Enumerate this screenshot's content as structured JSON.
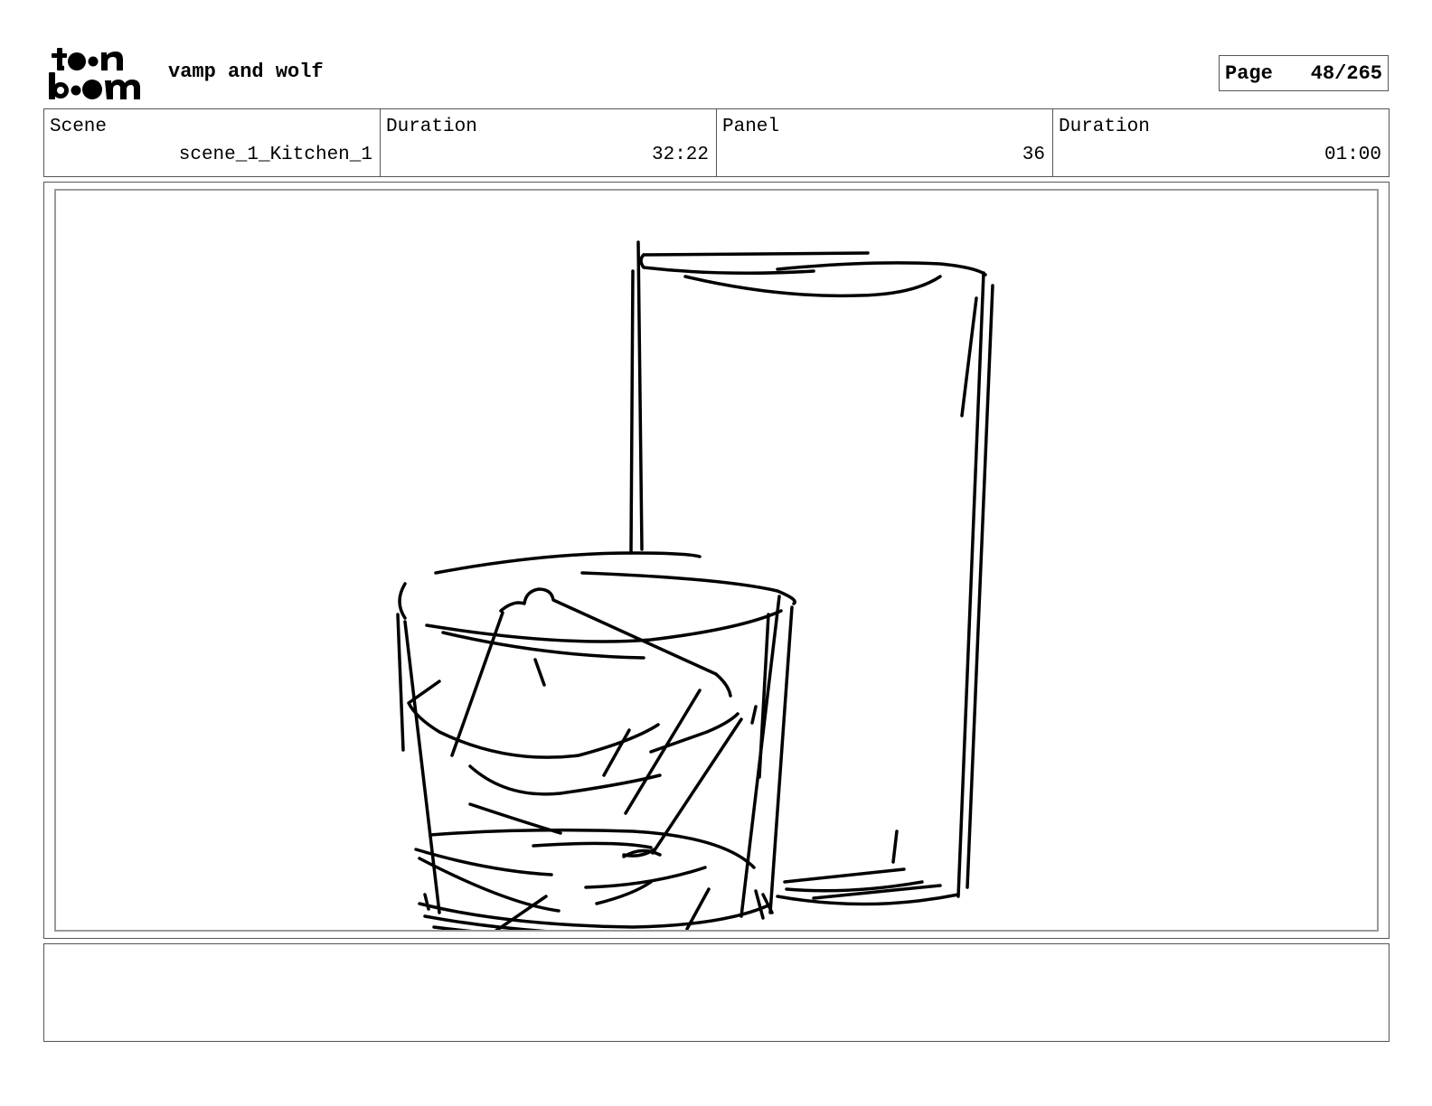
{
  "header": {
    "logo_text_top": "toon",
    "logo_text_bottom": "boom",
    "project_title": "vamp and wolf",
    "page_label": "Page",
    "page_number": "48/265"
  },
  "info": {
    "scene_label": "Scene",
    "scene_value": "scene_1_Kitchen_1",
    "scene_duration_label": "Duration",
    "scene_duration_value": "32:22",
    "panel_label": "Panel",
    "panel_value": "36",
    "panel_duration_label": "Duration",
    "panel_duration_value": "01:00"
  },
  "panel": {
    "drawing": "sketch-glasses"
  },
  "notes": {
    "text": ""
  }
}
